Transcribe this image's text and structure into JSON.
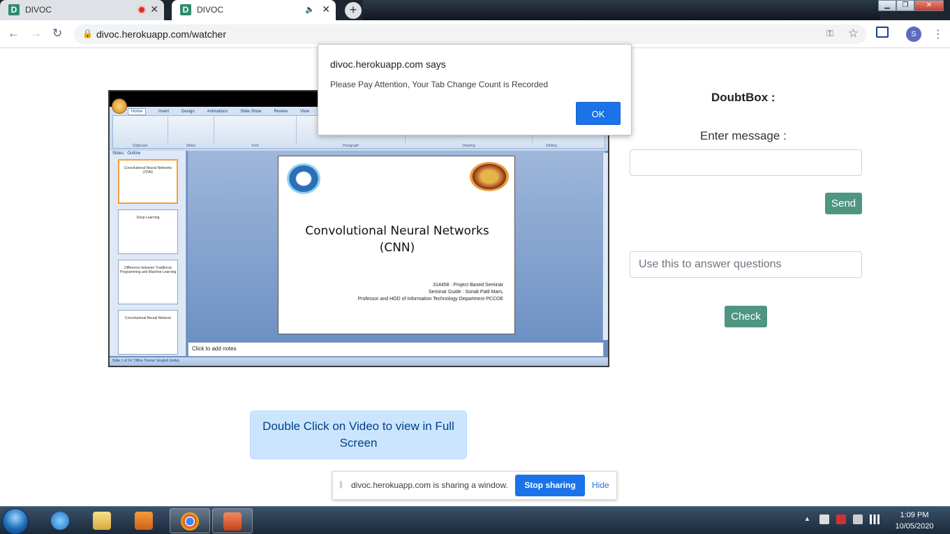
{
  "tabs": [
    {
      "favicon": "D",
      "title": "DIVOC",
      "indicator": "recording-icon"
    },
    {
      "favicon": "D",
      "title": "DIVOC",
      "indicator": "speaker-icon"
    }
  ],
  "toolbar": {
    "url": "divoc.herokuapp.com/watcher",
    "profile_initial": "S"
  },
  "alert": {
    "heading": "divoc.herokuapp.com says",
    "message": "Please Pay Attention, Your Tab Change Count is Recorded",
    "ok_label": "OK"
  },
  "video": {
    "ribbon_tabs": [
      "Home",
      "Insert",
      "Design",
      "Animations",
      "Slide Show",
      "Review",
      "View"
    ],
    "ribbon_groups": [
      "Clipboard",
      "Slides",
      "Font",
      "Paragraph",
      "Drawing",
      "Editing"
    ],
    "panel_tabs": [
      "Slides",
      "Outline"
    ],
    "thumbnails": [
      "Convolutional Neural Networks (CNN)",
      "Deep Learning",
      "Difference between Traditional Programming and Machine Learning",
      "Convolutional Neural Network"
    ],
    "slide_title_line1": "Convolutional Neural Networks",
    "slide_title_line2": "(CNN)",
    "slide_info_1": "314458 : Project Based Seminar",
    "slide_info_2": "Seminar Guide : Sonali Patil Mam,",
    "slide_info_3": "Professor and HOD of Information Technology Department PCCOE",
    "notes_placeholder": "Click to add notes",
    "status_text": "Slide 1 of 14     \"Office Theme\"     English (India)"
  },
  "fullscreen_hint": "Double Click on Video to view in Full Screen",
  "doubtbox": {
    "title": "DoubtBox :",
    "enter_label": "Enter message :",
    "message_value": "",
    "send_label": "Send",
    "answer_placeholder": "Use this to answer questions",
    "check_label": "Check"
  },
  "sharebar": {
    "message": "divoc.herokuapp.com is sharing a window.",
    "stop_label": "Stop sharing",
    "hide_label": "Hide"
  },
  "taskbar": {
    "time": "1:09 PM",
    "date": "10/05/2020"
  },
  "colors": {
    "accent_green": "#4e9582",
    "chrome_blue": "#1a73e8",
    "hint_bg": "#cce5ff"
  }
}
